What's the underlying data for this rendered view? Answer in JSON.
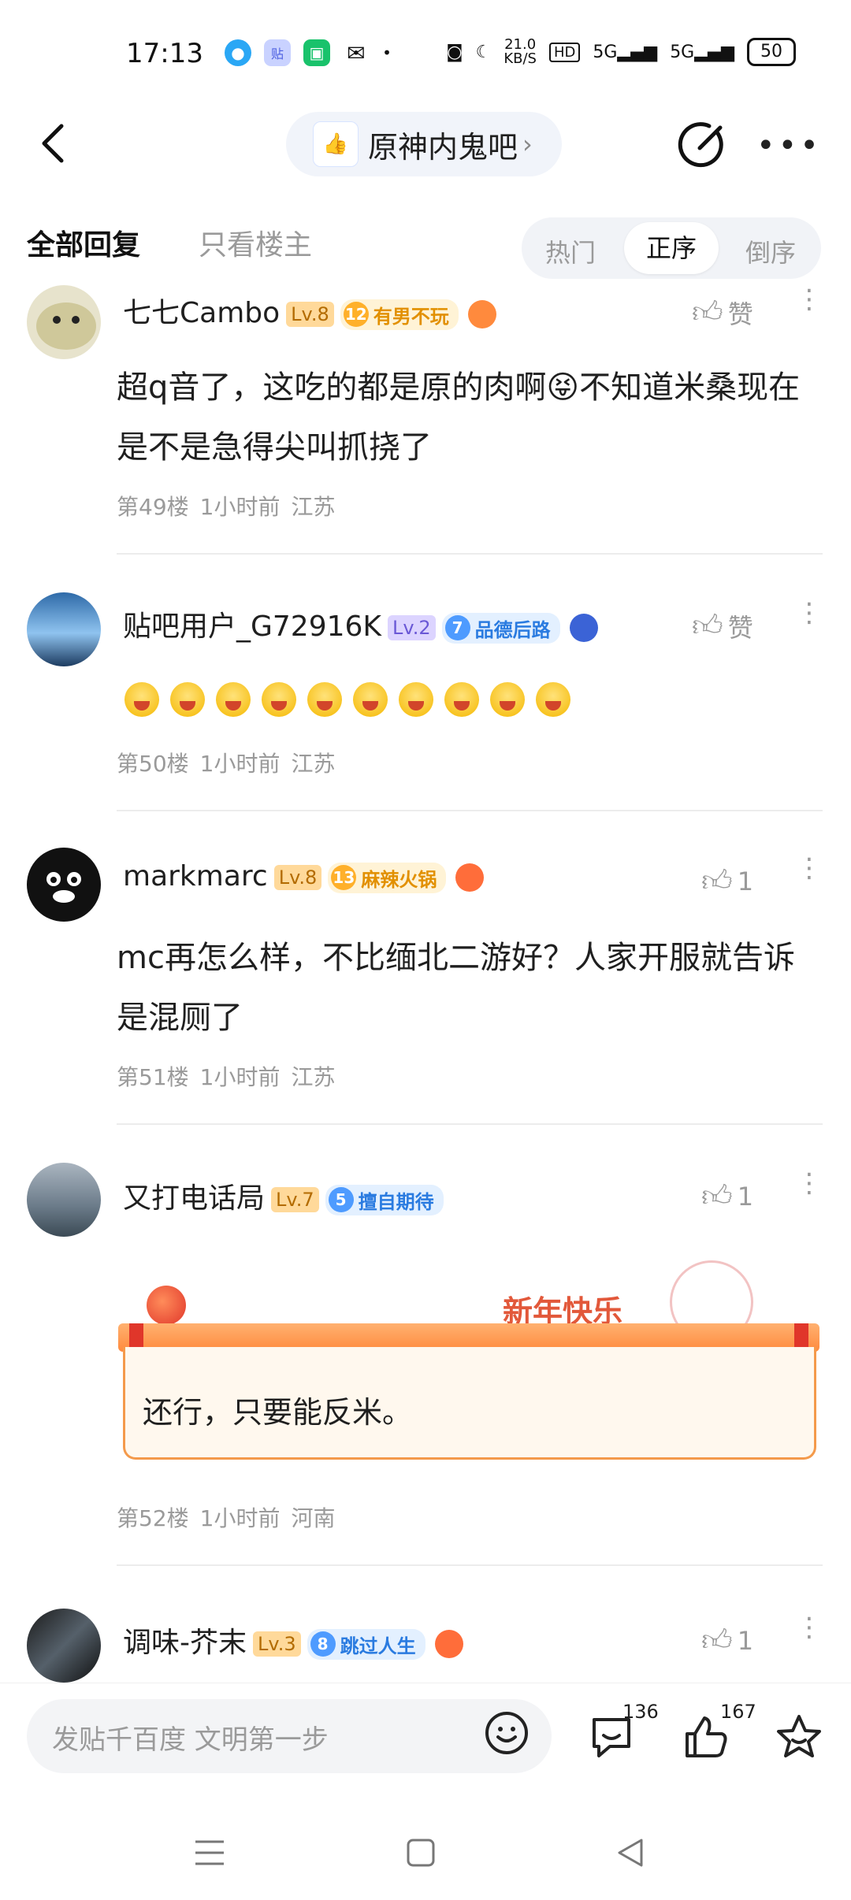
{
  "status_bar": {
    "time": "17:13",
    "speed_value": "21.0",
    "speed_unit": "KB/S",
    "hd_label": "HD",
    "net1": "5G",
    "net2": "5G",
    "battery": "50"
  },
  "header": {
    "forum_name": "原神内鬼吧",
    "forum_logo_text": "👍"
  },
  "tabs": {
    "all_replies": "全部回复",
    "op_only": "只看楼主",
    "sort_hot": "热门",
    "sort_asc": "正序",
    "sort_desc": "倒序"
  },
  "posts": [
    {
      "username": "七七Cambo",
      "level": "Lv.8",
      "badge_num": "12",
      "badge_label": "有男不玩",
      "like_label": "赞",
      "content": "超q音了，这吃的都是原的肉啊😝不知道米桑现在是不是急得尖叫抓挠了",
      "floor": "第49楼",
      "time": "1小时前",
      "location": "江苏"
    },
    {
      "username": "贴吧用户_G72916K",
      "level": "Lv.2",
      "badge_num": "7",
      "badge_label": "品德后路",
      "like_label": "赞",
      "emoji_count": 10,
      "floor": "第50楼",
      "time": "1小时前",
      "location": "江苏"
    },
    {
      "username": "markmarc",
      "level": "Lv.8",
      "badge_num": "13",
      "badge_label": "麻辣火锅",
      "like_count": "1",
      "content": "mc再怎么样，不比缅北二游好？人家开服就告诉是混厕了",
      "floor": "第51楼",
      "time": "1小时前",
      "location": "江苏"
    },
    {
      "username": "又打电话局",
      "level": "Lv.7",
      "badge_num": "5",
      "badge_label": "擅自期待",
      "like_count": "1",
      "card_title": "新年快乐",
      "content": "还行，只要能反米。",
      "floor": "第52楼",
      "time": "1小时前",
      "location": "河南"
    },
    {
      "username": "调味-芥末",
      "level": "Lv.3",
      "badge_num": "8",
      "badge_label": "跳过人生",
      "like_count": "1"
    }
  ],
  "bottom_bar": {
    "input_placeholder": "发贴千百度 文明第一步",
    "comment_count": "136",
    "like_count": "167"
  },
  "colors": {
    "accent_blue": "#2a7be0",
    "level_orange": "#ffd99a",
    "badge_orange": "#ffb02a",
    "text_secondary": "#9a9a9a"
  }
}
